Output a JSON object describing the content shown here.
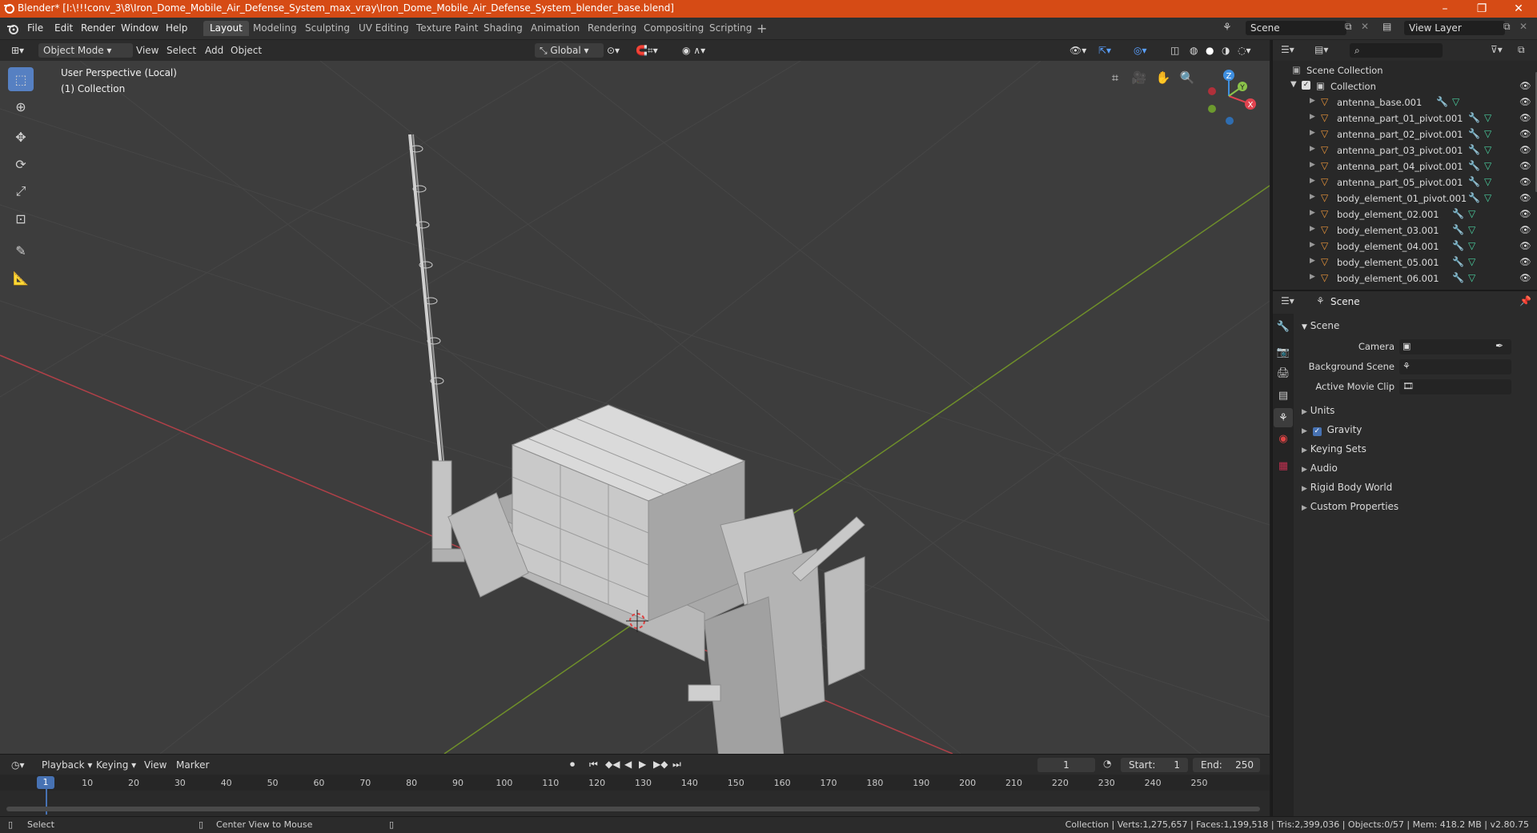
{
  "title": "Blender* [I:\\!!!conv_3\\8\\Iron_Dome_Mobile_Air_Defense_System_max_vray\\Iron_Dome_Mobile_Air_Defense_System_blender_base.blend]",
  "menu": [
    "File",
    "Edit",
    "Render",
    "Window",
    "Help"
  ],
  "workspaces": [
    "Layout",
    "Modeling",
    "Sculpting",
    "UV Editing",
    "Texture Paint",
    "Shading",
    "Animation",
    "Rendering",
    "Compositing",
    "Scripting"
  ],
  "scene_field": "Scene",
  "view_layer_field": "View Layer",
  "viewport_header": {
    "mode": "Object Mode",
    "view": "View",
    "select": "Select",
    "add": "Add",
    "object": "Object",
    "orientation": "Global"
  },
  "viewport": {
    "perspective": "User Perspective (Local)",
    "collection": "(1) Collection"
  },
  "tools": [
    "select-box",
    "cursor",
    "move",
    "rotate",
    "scale",
    "transform",
    "annotate",
    "measure"
  ],
  "gizmo": {
    "x": "X",
    "y": "Y",
    "z": "Z"
  },
  "outliner": {
    "root": "Scene Collection",
    "collection": "Collection",
    "items": [
      "antenna_base.001",
      "antenna_part_01_pivot.001",
      "antenna_part_02_pivot.001",
      "antenna_part_03_pivot.001",
      "antenna_part_04_pivot.001",
      "antenna_part_05_pivot.001",
      "body_element_01_pivot.001",
      "body_element_02.001",
      "body_element_03.001",
      "body_element_04.001",
      "body_element_05.001",
      "body_element_06.001"
    ]
  },
  "properties": {
    "header": "Scene",
    "section": "Scene",
    "camera_label": "Camera",
    "background_label": "Background Scene",
    "movieclip_label": "Active Movie Clip",
    "panels": [
      "Units",
      "Gravity",
      "Keying Sets",
      "Audio",
      "Rigid Body World",
      "Custom Properties"
    ],
    "gravity_checked": true
  },
  "timeline": {
    "playback": "Playback",
    "keying": "Keying",
    "view": "View",
    "marker": "Marker",
    "current_frame": "1",
    "start_label": "Start:",
    "start": "1",
    "end_label": "End:",
    "end": "250",
    "ticks": [
      "1",
      "10",
      "20",
      "30",
      "40",
      "50",
      "60",
      "70",
      "80",
      "90",
      "100",
      "110",
      "120",
      "130",
      "140",
      "150",
      "160",
      "170",
      "180",
      "190",
      "200",
      "210",
      "220",
      "230",
      "240",
      "250"
    ]
  },
  "status": {
    "left": "Select",
    "middle": "Center View to Mouse",
    "right": "Collection | Verts:1,275,657 | Faces:1,199,518 | Tris:2,399,036 | Objects:0/57 | Mem: 418.2 MB | v2.80.75"
  },
  "colors": {
    "titlebar": "#d64b15",
    "active_tool": "#5680c2",
    "x_axis": "#e0434f",
    "y_axis": "#8bc34a",
    "z_axis": "#3f8fe0"
  }
}
